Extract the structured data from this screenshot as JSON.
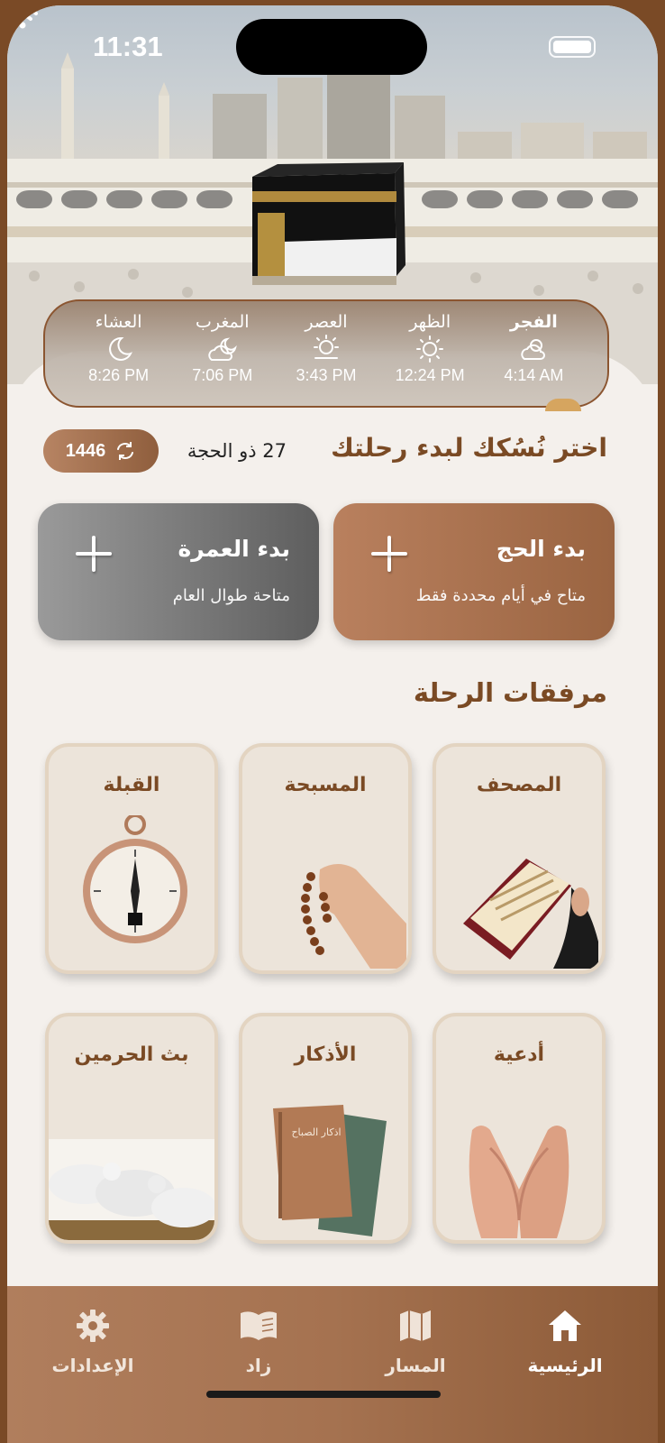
{
  "status_bar": {
    "time": "11:31"
  },
  "prayer_times": [
    {
      "name": "الفجر",
      "time": "4:14 AM",
      "icon": "cloud-sun-icon",
      "active": true
    },
    {
      "name": "الظهر",
      "time": "12:24 PM",
      "icon": "sun-icon",
      "active": false
    },
    {
      "name": "العصر",
      "time": "3:43 PM",
      "icon": "sun-haze-icon",
      "active": false
    },
    {
      "name": "المغرب",
      "time": "7:06 PM",
      "icon": "cloud-moon-icon",
      "active": false
    },
    {
      "name": "العشاء",
      "time": "8:26 PM",
      "icon": "moon-icon",
      "active": false
    }
  ],
  "header": {
    "title": "اختر نُسُكك لبدء رحلتك",
    "hijri_date": "27 ذو الحجة",
    "hijri_year": "1446"
  },
  "start_cards": {
    "hajj": {
      "title": "بدء الحج",
      "subtitle": "متاح في أيام محددة فقط"
    },
    "umrah": {
      "title": "بدء العمرة",
      "subtitle": "متاحة طوال العام"
    }
  },
  "companions": {
    "title": "مرفقات الرحلة",
    "items": [
      {
        "label": "المصحف",
        "icon": "quran-icon"
      },
      {
        "label": "المسبحة",
        "icon": "prayer-beads-icon"
      },
      {
        "label": "القبلة",
        "icon": "qibla-compass-icon"
      },
      {
        "label": "أدعية",
        "icon": "praying-hands-icon"
      },
      {
        "label": "الأذكار",
        "icon": "adhkar-books-icon"
      },
      {
        "label": "بث الحرمين",
        "icon": "haramain-broadcast-icon"
      }
    ],
    "adhkar_book_text": "اذكار الصباح"
  },
  "tabbar": {
    "items": [
      {
        "label": "الرئيسية",
        "icon": "home-icon",
        "active": true
      },
      {
        "label": "المسار",
        "icon": "map-icon",
        "active": false
      },
      {
        "label": "زاد",
        "icon": "book-icon",
        "active": false
      },
      {
        "label": "الإعدادات",
        "icon": "gear-icon",
        "active": false
      }
    ]
  },
  "colors": {
    "brand_brown": "#7a4a24",
    "hajj_card": "#a86f4c",
    "umrah_card": "#7d7d7d",
    "background": "#f4f0ec"
  }
}
